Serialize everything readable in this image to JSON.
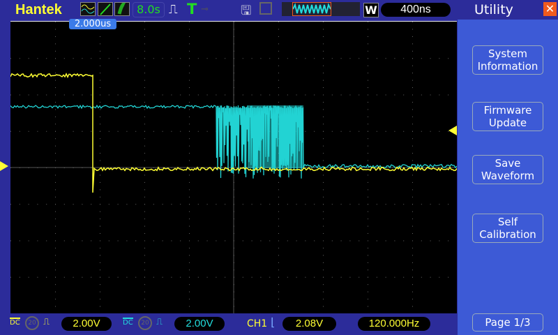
{
  "header": {
    "brand": "Hantek",
    "run_time": "8.0s",
    "time_base": "400ns",
    "window_label": "W"
  },
  "trigger_pos": "2.000us",
  "sidebar": {
    "title": "Utility",
    "buttons": [
      "System\nInformation",
      "Firmware\nUpdate",
      "Save\nWaveform",
      "Self\nCalibration"
    ],
    "page": "Page 1/3"
  },
  "footer": {
    "ch1_coupling": "DC",
    "ch1_scale": "2.00V",
    "ch2_coupling": "DC",
    "ch2_scale": "2.00V",
    "trig_source": "CH1",
    "trig_level": "2.08V",
    "frequency": "120.000Hz"
  },
  "colors": {
    "ch1": "#ffff33",
    "ch2": "#22d3d3",
    "accent": "#f05a1e"
  }
}
